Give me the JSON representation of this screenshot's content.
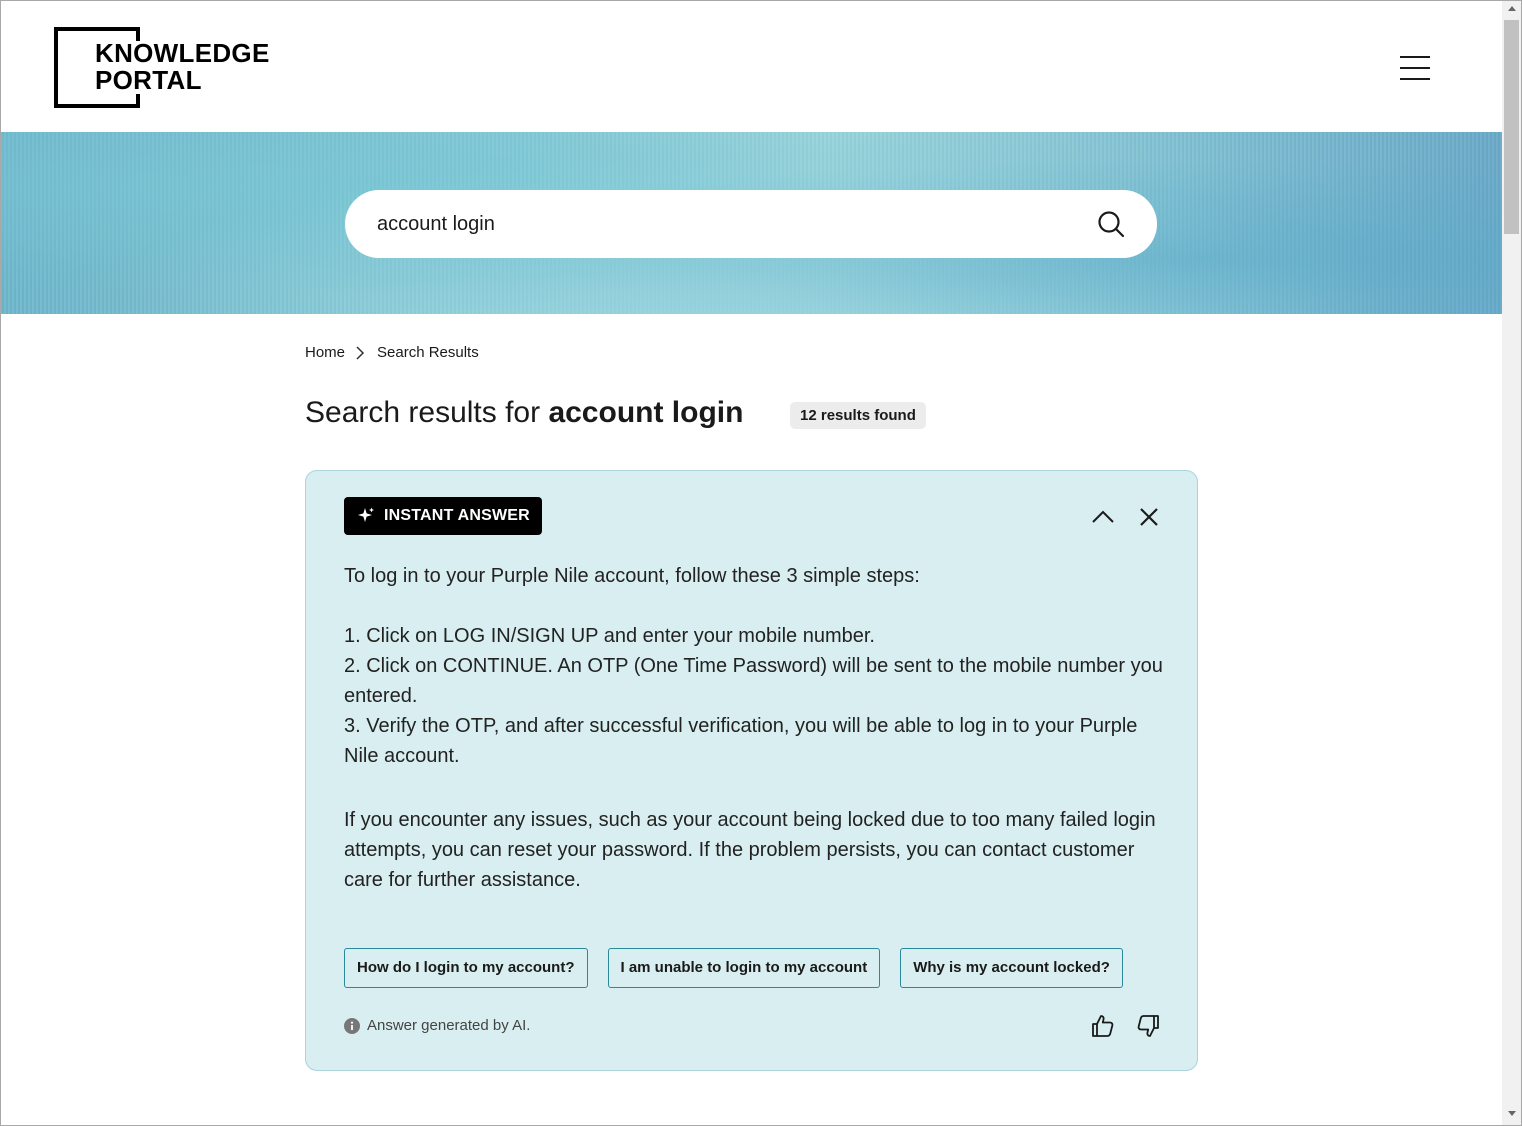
{
  "header": {
    "logo_line1": "KNOWLEDGE",
    "logo_line2": "PORTAL",
    "menu_icon": "hamburger-menu-icon"
  },
  "search": {
    "value": "account login",
    "icon": "search-icon"
  },
  "breadcrumb": {
    "items": [
      "Home",
      "Search Results"
    ]
  },
  "results": {
    "title_prefix": "Search results for ",
    "query": "account login",
    "count_badge": "12 results found"
  },
  "instant_answer": {
    "badge_label": "INSTANT ANSWER",
    "badge_icon": "sparkle-icon",
    "intro": "To log in to your Purple Nile account, follow these 3 simple steps:",
    "steps": [
      "1. Click on LOG IN/SIGN UP and enter your mobile number.",
      "2. Click on CONTINUE. An OTP (One Time Password) will be sent to the mobile number you entered.",
      "3. Verify the OTP, and after successful verification, you will be able to log in to your Purple Nile account."
    ],
    "followup": "If you encounter any issues, such as your account being locked due to too many failed login attempts, you can reset your password. If the problem persists, you can contact customer care for further assistance.",
    "suggestions": [
      "How do I login to my account?",
      "I am unable to login to my account",
      "Why is my account locked?"
    ],
    "ai_note": "Answer generated by AI."
  },
  "colors": {
    "card_bg": "#d8eef0",
    "card_border": "#aad4da",
    "chip_border": "#2a8a9a",
    "badge_bg": "#000000"
  }
}
